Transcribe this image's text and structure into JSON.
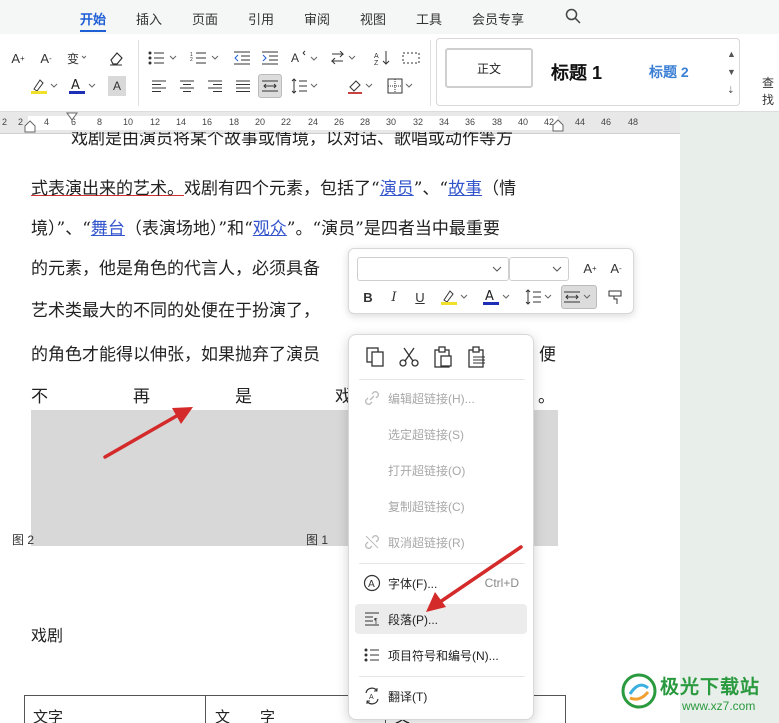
{
  "tabs": [
    "开始",
    "插入",
    "页面",
    "引用",
    "审阅",
    "视图",
    "工具",
    "会员专享"
  ],
  "active_tab": "开始",
  "styles": {
    "normal": "正文",
    "heading1": "标题 1",
    "heading2": "标题 2"
  },
  "find_label": "查找",
  "ruler_numbers": [
    "2",
    "2",
    "4",
    "6",
    "8",
    "10",
    "12",
    "14",
    "16",
    "18",
    "20",
    "22",
    "24",
    "26",
    "28",
    "30",
    "32",
    "34",
    "36",
    "38",
    "40",
    "42",
    "44",
    "46",
    "48"
  ],
  "document": {
    "line0": "戏剧是由演员将某个故事或情境，以对话、歌唱或动作等方",
    "line1_a": "式表演出来的艺术。",
    "line1_b": "戏剧有四个元素，包括了“",
    "line1_link1": "演员",
    "line1_c": "”、“",
    "line1_link2": "故事",
    "line1_d": "（情",
    "line2_a": "境）”、“",
    "line2_link1": "舞台",
    "line2_b": "（表演场地）”和“",
    "line2_link2": "观众",
    "line2_c": "”。“演员”是四者当中最重要",
    "line3": "的元素，他是角色的代言人，必须具备",
    "line4": "艺术类最大的不同的处便在于扮演了，",
    "line5_a": "的角色才能得以伸张，如果抛弃了演员",
    "line5_b": "便",
    "line6": [
      "不",
      "再",
      "是",
      "戏",
      "。"
    ],
    "caption_fig2": "图 2",
    "caption_fig1": "图 1",
    "heading": "戏剧",
    "table_cells": [
      "文字",
      "文　　字",
      "文"
    ]
  },
  "context_menu": {
    "items": [
      {
        "label": "编辑超链接(H)...",
        "shortcut": "",
        "disabled": true,
        "icon": "link-edit-icon"
      },
      {
        "label": "选定超链接(S)",
        "shortcut": "",
        "disabled": true,
        "icon": ""
      },
      {
        "label": "打开超链接(O)",
        "shortcut": "",
        "disabled": true,
        "icon": ""
      },
      {
        "label": "复制超链接(C)",
        "shortcut": "",
        "disabled": true,
        "icon": ""
      },
      {
        "label": "取消超链接(R)",
        "shortcut": "",
        "disabled": true,
        "icon": "unlink-icon"
      },
      {
        "label": "字体(F)...",
        "shortcut": "Ctrl+D",
        "disabled": false,
        "icon": "font-icon"
      },
      {
        "label": "段落(P)...",
        "shortcut": "",
        "disabled": false,
        "icon": "paragraph-icon"
      },
      {
        "label": "项目符号和编号(N)...",
        "shortcut": "",
        "disabled": false,
        "icon": "bullets-icon"
      },
      {
        "label": "翻译(T)",
        "shortcut": "",
        "disabled": false,
        "icon": "translate-icon"
      }
    ]
  },
  "watermark": {
    "text": "极光下载站",
    "sub": "www.xz7.com"
  },
  "colors": {
    "accent": "#1f5fd6",
    "link": "#3355cc",
    "arrow": "#d42a2a",
    "selection": "#d8d8d8",
    "watermark": "#2a9a3e"
  }
}
